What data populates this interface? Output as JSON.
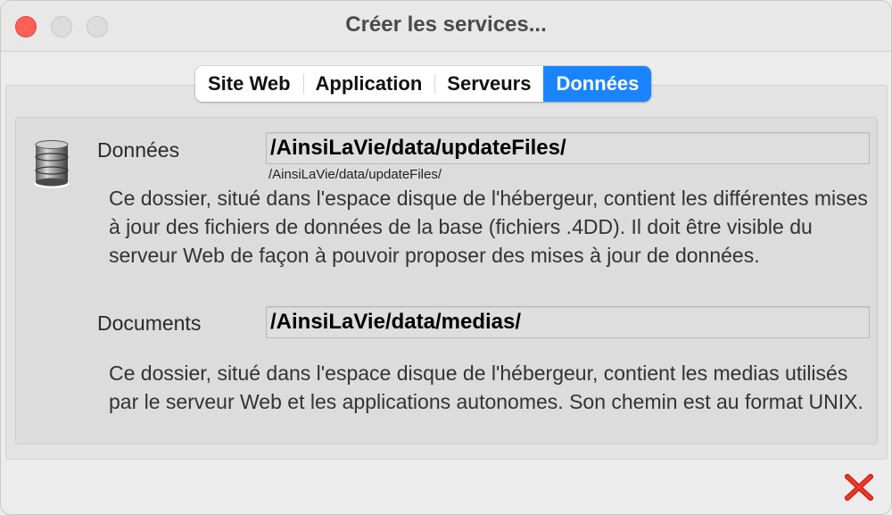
{
  "window": {
    "title": "Créer les services..."
  },
  "tabs": [
    {
      "label": "Site Web",
      "active": false
    },
    {
      "label": "Application",
      "active": false
    },
    {
      "label": "Serveurs",
      "active": false
    },
    {
      "label": "Données",
      "active": true
    }
  ],
  "data_section": {
    "label": "Données",
    "path": "/AinsiLaVie/data/updateFiles/",
    "path_hint": "/AinsiLaVie/data/updateFiles/",
    "description": "Ce dossier, situé dans l'espace disque de l'hébergeur, contient les différentes mises à jour des fichiers de données de la base (fichiers .4DD). Il doit être visible du serveur Web de façon à pouvoir proposer des mises à jour de données."
  },
  "documents_section": {
    "label": "Documents",
    "path": "/AinsiLaVie/data/medias/",
    "description": "Ce dossier, situé dans l'espace disque de l'hébergeur, contient les medias utilisés par le serveur Web et les applications autonomes. Son chemin est au format UNIX."
  },
  "icons": {
    "database": "database-icon",
    "close": "red-x-close-icon"
  },
  "colors": {
    "accent": "#1a84ff",
    "close_red": "#d6261c",
    "traffic_close": "#fe5f57"
  }
}
